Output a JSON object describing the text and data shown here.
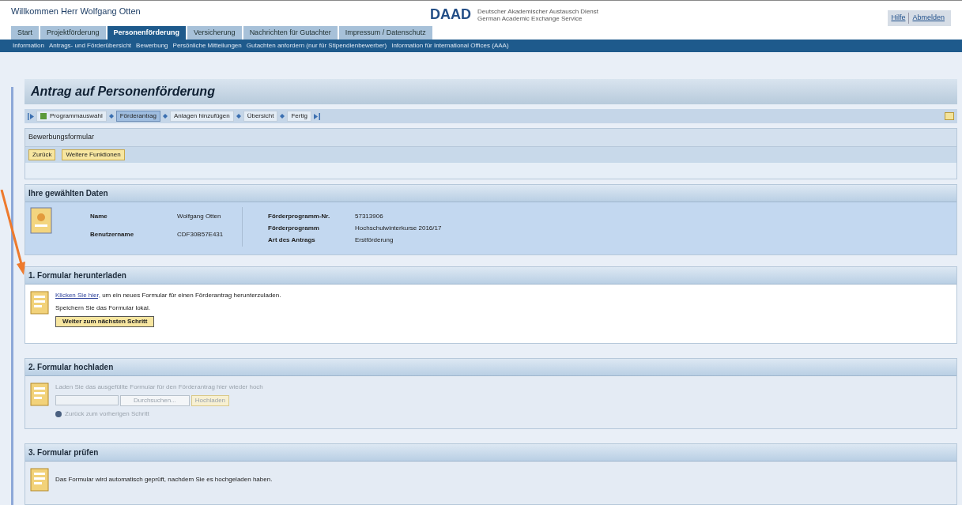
{
  "header": {
    "welcome": "Willkommen Herr Wolfgang Otten",
    "logo": "DAAD",
    "logo_line_1": "Deutscher Akademischer Austausch Dienst",
    "logo_line_2": "German Academic Exchange Service",
    "links": [
      "Hilfe",
      "Abmelden"
    ]
  },
  "tabs": [
    {
      "label": "Start",
      "selected": false
    },
    {
      "label": "Projektförderung",
      "selected": false
    },
    {
      "label": "Personenförderung",
      "selected": true
    },
    {
      "label": "Versicherung",
      "selected": false
    },
    {
      "label": "Nachrichten für Gutachter",
      "selected": false
    },
    {
      "label": "Impressum / Datenschutz",
      "selected": false
    }
  ],
  "subnav": [
    "Information",
    "Antrags- und Förderübersicht",
    "Bewerbung",
    "Persönliche Mitteilungen",
    "Gutachten anfordern (nur für Stipendienbewerber)",
    "Information für International Offices (AAA)"
  ],
  "page_title": "Antrag auf Personenförderung",
  "steps": [
    {
      "label": "Programmauswahl",
      "selected": false,
      "done": true
    },
    {
      "label": "Förderantrag",
      "selected": true,
      "done": false
    },
    {
      "label": "Anlagen hinzufügen",
      "selected": false,
      "done": false
    },
    {
      "label": "Übersicht",
      "selected": false,
      "done": false
    },
    {
      "label": "Fertig",
      "selected": false,
      "done": false
    }
  ],
  "form_panel": {
    "title": "Bewerbungsformular",
    "buttons": [
      "Zurück",
      "Weitere Funktionen"
    ]
  },
  "data_panel": {
    "title": "Ihre gewählten Daten",
    "left": [
      {
        "label": "Name",
        "value": "Wolfgang Otten"
      },
      {
        "label": "Benutzername",
        "value": "CDF30B57E431"
      }
    ],
    "right": [
      {
        "label": "Förderprogramm-Nr.",
        "value": "57313906"
      },
      {
        "label": "Förderprogramm",
        "value": "Hochschulwinterkurse 2016/17"
      },
      {
        "label": "Art des Antrags",
        "value": "Erstförderung"
      }
    ]
  },
  "section_1": {
    "title": "1. Formular herunterladen",
    "link": "Klicken Sie hier,",
    "text": " um ein neues Formular für einen Förderantrag herunterzuladen.",
    "note": "Speichern Sie das Formular lokal.",
    "button": "Weiter zum nächsten Schritt"
  },
  "section_2": {
    "title": "2. Formular hochladen",
    "disabled": true,
    "text": "Laden Sie das ausgefüllte Formular für den Förderantrag hier wieder hoch",
    "browse": "Durchsuchen...",
    "upload": "Hochladen",
    "back": "Zurück zum vorherigen Schritt"
  },
  "section_3": {
    "title": "3. Formular prüfen",
    "text": "Das Formular wird automatisch geprüft, nachdem Sie es hochgeladen haben."
  }
}
